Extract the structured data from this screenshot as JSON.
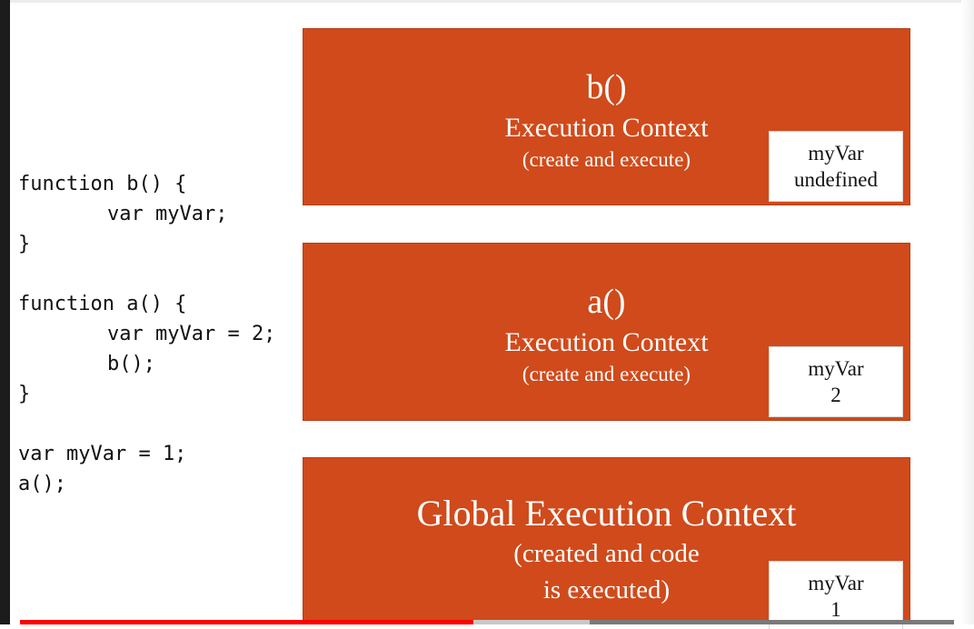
{
  "code_lines": [
    {
      "text": "function b() {",
      "indent": false
    },
    {
      "text": "var myVar;",
      "indent": true
    },
    {
      "text": "}",
      "indent": false
    },
    {
      "text": "",
      "indent": false
    },
    {
      "text": "function a() {",
      "indent": false
    },
    {
      "text": "var myVar = 2;",
      "indent": true
    },
    {
      "text": "b();",
      "indent": true
    },
    {
      "text": "}",
      "indent": false
    },
    {
      "text": "",
      "indent": false
    },
    {
      "text": "var myVar = 1;",
      "indent": false
    },
    {
      "text": "a();",
      "indent": false
    }
  ],
  "contexts": {
    "b": {
      "name": "b()",
      "label": "Execution Context",
      "sub": "(create and execute)",
      "var_name": "myVar",
      "var_value": "undefined"
    },
    "a": {
      "name": "a()",
      "label": "Execution Context",
      "sub": "(create and execute)",
      "var_name": "myVar",
      "var_value": "2"
    },
    "global": {
      "label": "Global Execution Context",
      "sub_line1": "(created and code",
      "sub_line2": "is executed)",
      "var_name": "myVar",
      "var_value": "1"
    }
  },
  "colors": {
    "context_fill": "#d04a1b",
    "progress_played": "#ff0000"
  },
  "video_progress": {
    "played_fraction": 0.485,
    "buffered_fraction": 0.61
  }
}
